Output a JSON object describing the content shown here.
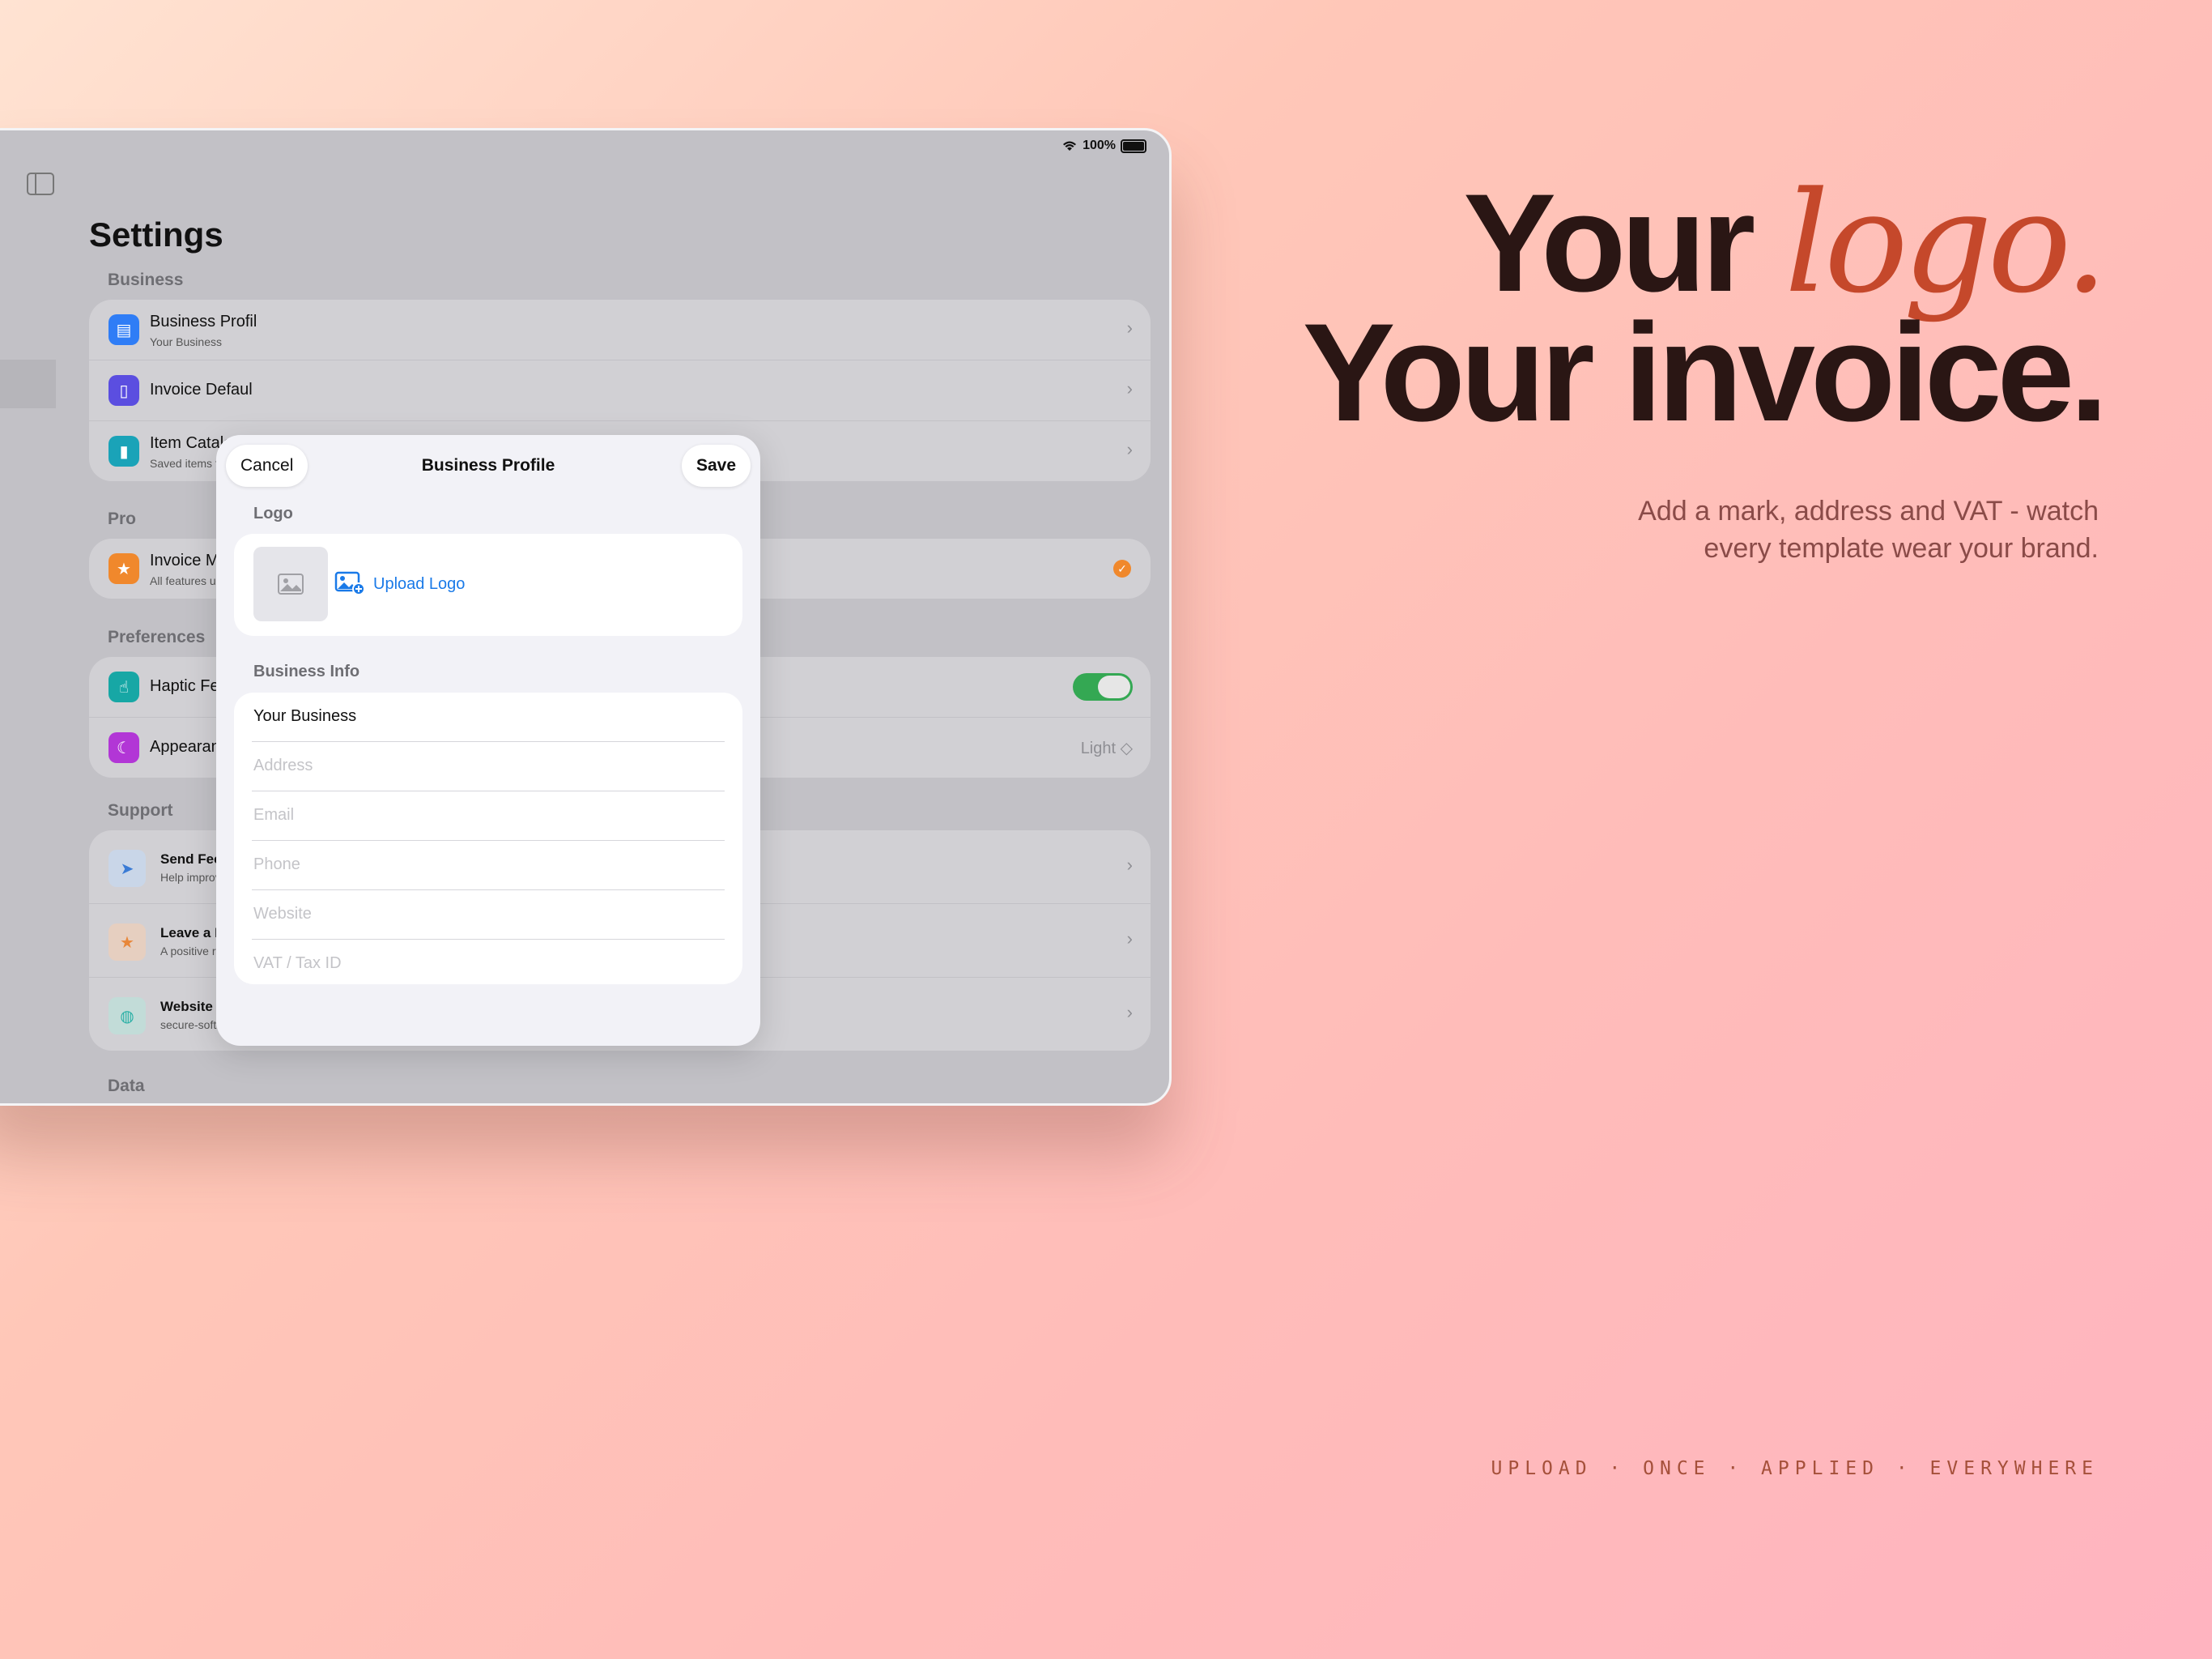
{
  "marketing": {
    "headline_your": "Your",
    "headline_logo": "logo.",
    "headline_line2": "Your invoice.",
    "subtext": "Add a mark, address and VAT - watch every template wear your brand.",
    "tagline": "UPLOAD · ONCE · APPLIED · EVERYWHERE"
  },
  "status_bar": {
    "battery": "100%"
  },
  "settings": {
    "title": "Settings",
    "sections": {
      "business": {
        "label": "Business",
        "rows": [
          {
            "title": "Business Profil",
            "subtitle": "Your Business",
            "icon": "building-icon",
            "color": "#2f7df6"
          },
          {
            "title": "Invoice Defaul",
            "subtitle": "",
            "icon": "document-icon",
            "color": "#5b4ee0"
          },
          {
            "title": "Item Catalog",
            "subtitle": "Saved items for qui",
            "icon": "bookmark-icon",
            "color": "#1aa3b8"
          }
        ]
      },
      "pro": {
        "label": "Pro",
        "rows": [
          {
            "title": "Invoice Maker",
            "subtitle": "All features unlocke",
            "icon": "star-icon",
            "color": "#f0882c",
            "badge": "verified-badge-icon"
          }
        ]
      },
      "preferences": {
        "label": "Preferences",
        "rows": [
          {
            "title": "Haptic Feedba",
            "icon": "hand-tap-icon",
            "color": "#17a7a5",
            "toggle": true
          },
          {
            "title": "Appearance",
            "icon": "moon-icon",
            "color": "#b236d6",
            "value": "Light ◇"
          }
        ]
      },
      "support": {
        "label": "Support",
        "rows": [
          {
            "title": "Send Feedba",
            "subtitle": "Help improve the",
            "icon": "paperplane-icon",
            "color": "#3a7bd5"
          },
          {
            "title": "Leave a Review",
            "subtitle": "A positive review on the App Store makes a huge difference!",
            "icon": "star-icon",
            "color": "#e8873a"
          },
          {
            "title": "Website",
            "subtitle": "secure-software.org",
            "icon": "globe-icon",
            "color": "#2bb0a6"
          }
        ]
      },
      "data": {
        "label": "Data"
      }
    }
  },
  "sheet": {
    "title": "Business Profile",
    "cancel": "Cancel",
    "save": "Save",
    "logo_label": "Logo",
    "upload_label": "Upload Logo",
    "info_label": "Business Info",
    "fields": {
      "name": "Your Business",
      "address": "Address",
      "email": "Email",
      "phone": "Phone",
      "website": "Website",
      "vat": "VAT / Tax ID"
    }
  }
}
